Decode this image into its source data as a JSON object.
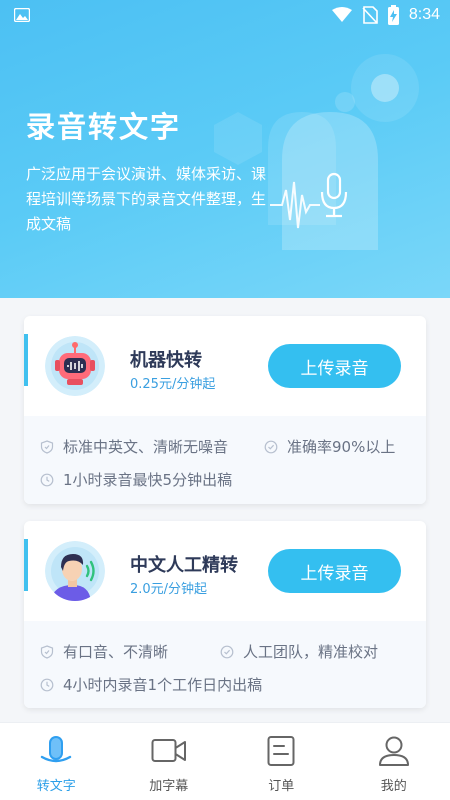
{
  "status": {
    "time": "8:34"
  },
  "hero": {
    "title": "录音转文字",
    "description": "广泛应用于会议演讲、媒体采访、课程培训等场景下的录音文件整理，生成文稿"
  },
  "services": [
    {
      "name": "机器快转",
      "price": "0.25元/分钟起",
      "button": "上传录音",
      "features": [
        "标准中英文、清晰无噪音",
        "准确率90%以上",
        "1小时录音最快5分钟出稿"
      ]
    },
    {
      "name": "中文人工精转",
      "price": "2.0元/分钟起",
      "button": "上传录音",
      "features": [
        "有口音、不清晰",
        "人工团队，精准校对",
        "4小时内录音1个工作日内出稿"
      ]
    }
  ],
  "tabs": [
    {
      "label": "转文字",
      "icon": "microphone-icon",
      "active": true
    },
    {
      "label": "加字幕",
      "icon": "video-camera-icon",
      "active": false
    },
    {
      "label": "订单",
      "icon": "order-icon",
      "active": false
    },
    {
      "label": "我的",
      "icon": "user-icon",
      "active": false
    }
  ],
  "colors": {
    "accent": "#34bff0",
    "hero_start": "#4cc0f3",
    "active_tab": "#2b9fe8"
  }
}
